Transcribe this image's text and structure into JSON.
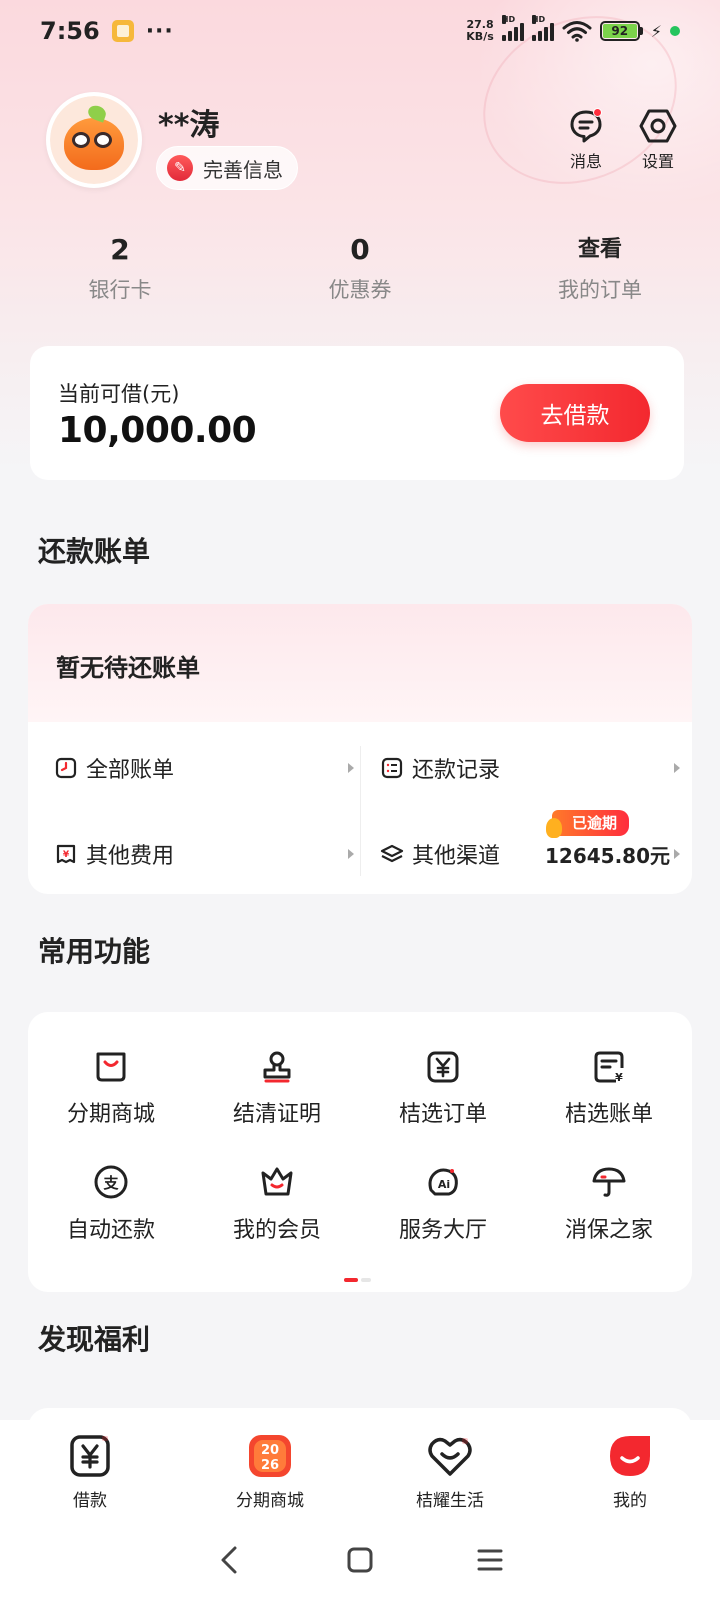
{
  "status_bar": {
    "time": "7:56",
    "more": "···",
    "net_speed_value": "27.8",
    "net_speed_unit": "KB/s",
    "hd1": "HD",
    "hd2": "HD",
    "battery": "92"
  },
  "profile": {
    "username": "**涛",
    "complete_info": "完善信息",
    "messages_label": "消息",
    "settings_label": "设置"
  },
  "stats": [
    {
      "value": "2",
      "label": "银行卡"
    },
    {
      "value": "0",
      "label": "优惠券"
    },
    {
      "value": "查看",
      "label": "我的订单"
    }
  ],
  "loan": {
    "label": "当前可借(元)",
    "amount": "10,000.00",
    "button": "去借款"
  },
  "bills": {
    "title": "还款账单",
    "empty": "暂无待还账单",
    "items": [
      {
        "label": "全部账单",
        "icon": "all-bills-icon"
      },
      {
        "label": "还款记录",
        "icon": "repay-record-icon"
      },
      {
        "label": "其他费用",
        "icon": "other-fees-icon"
      },
      {
        "label": "其他渠道",
        "icon": "other-channels-icon",
        "amount": "12645.80元",
        "badge": "已逾期"
      }
    ]
  },
  "functions": {
    "title": "常用功能",
    "items": [
      {
        "label": "分期商城",
        "icon": "shopping-bag-icon"
      },
      {
        "label": "结清证明",
        "icon": "stamp-icon"
      },
      {
        "label": "桔选订单",
        "icon": "yuan-order-icon"
      },
      {
        "label": "桔选账单",
        "icon": "yuan-bill-icon"
      },
      {
        "label": "自动还款",
        "icon": "auto-repay-icon"
      },
      {
        "label": "我的会员",
        "icon": "crown-icon"
      },
      {
        "label": "服务大厅",
        "icon": "ai-service-icon"
      },
      {
        "label": "消保之家",
        "icon": "umbrella-icon"
      }
    ]
  },
  "welfare": {
    "title": "发现福利"
  },
  "bottom_nav": [
    {
      "label": "借款",
      "icon": "loan-yuan-icon"
    },
    {
      "label": "分期商城",
      "icon": "mall-2026-icon",
      "icon_text_top": "20",
      "icon_text_bottom": "26"
    },
    {
      "label": "桔耀生活",
      "icon": "heart-life-icon"
    },
    {
      "label": "我的",
      "icon": "me-smile-icon"
    }
  ],
  "colors": {
    "accent": "#f3282f",
    "overdue_badge": "#ff3a3a",
    "background": "#f5f5f7"
  }
}
